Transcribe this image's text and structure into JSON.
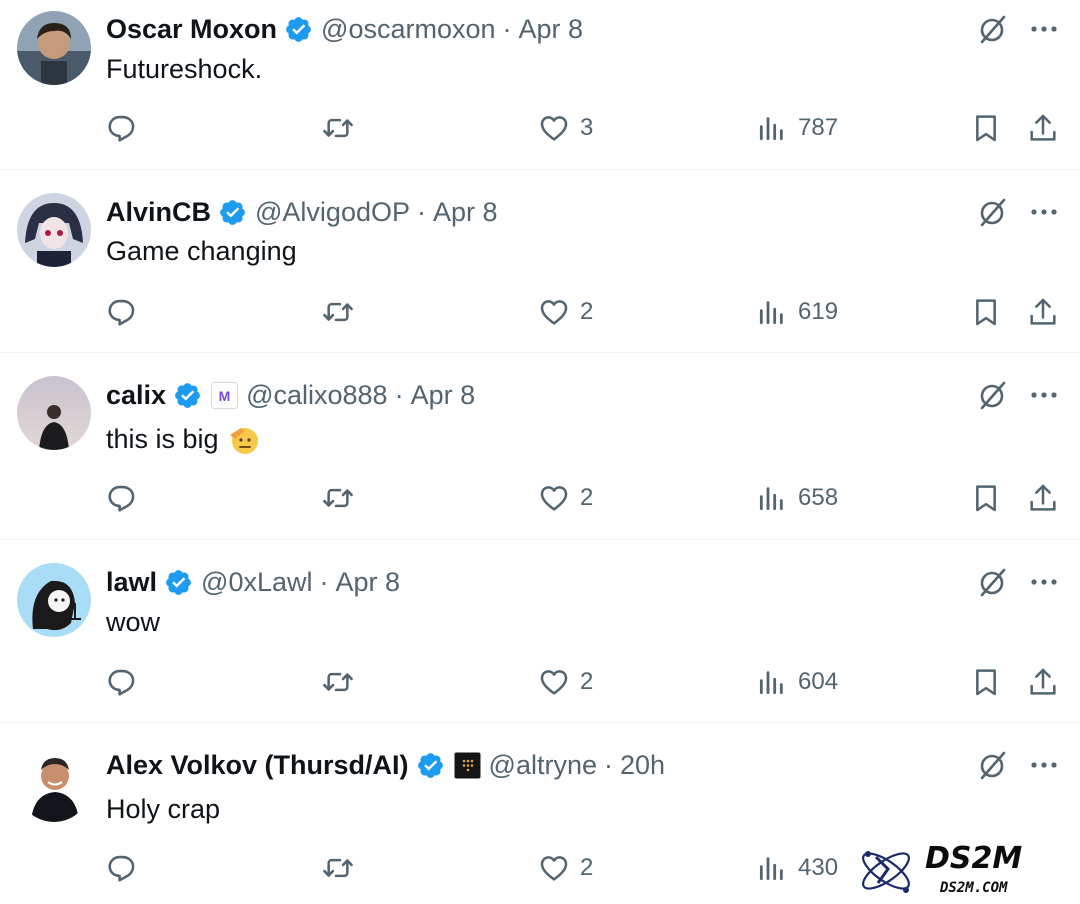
{
  "tweets": [
    {
      "name": "Oscar Moxon",
      "handle": "@oscarmoxon",
      "sep": "·",
      "time": "Apr 8",
      "text": "Futureshock.",
      "replies": "",
      "reposts": "",
      "likes": "3",
      "views": "787"
    },
    {
      "name": "AlvinCB",
      "handle": "@AlvigodOP",
      "sep": "·",
      "time": "Apr 8",
      "text": "Game changing",
      "replies": "",
      "reposts": "",
      "likes": "2",
      "views": "619"
    },
    {
      "name": "calix",
      "handle": "@calixo888",
      "sep": "·",
      "time": "Apr 8",
      "text": "this is big",
      "affiliate_badge": "M",
      "replies": "",
      "reposts": "",
      "likes": "2",
      "views": "658"
    },
    {
      "name": "lawl",
      "handle": "@0xLawl",
      "sep": "·",
      "time": "Apr 8",
      "text": "wow",
      "replies": "",
      "reposts": "",
      "likes": "2",
      "views": "604"
    },
    {
      "name": "Alex Volkov (Thursd/AI)",
      "handle": "@altryne",
      "sep": "·",
      "time": "20h",
      "text": "Holy crap",
      "replies": "",
      "reposts": "",
      "likes": "2",
      "views": "430"
    }
  ],
  "watermark": {
    "title": "DS2M",
    "subtitle": "DS2M.COM"
  },
  "icons": {
    "verified": "verified-badge-icon",
    "grok": "grok-icon",
    "more": "more-icon",
    "reply": "reply-icon",
    "repost": "repost-icon",
    "like": "heart-icon",
    "views": "analytics-icon",
    "bookmark": "bookmark-icon",
    "share": "share-icon"
  },
  "colors": {
    "verified": "#1d9bf0",
    "secondary_text": "#536471",
    "text": "#0f1419",
    "divider": "#eff3f4"
  }
}
